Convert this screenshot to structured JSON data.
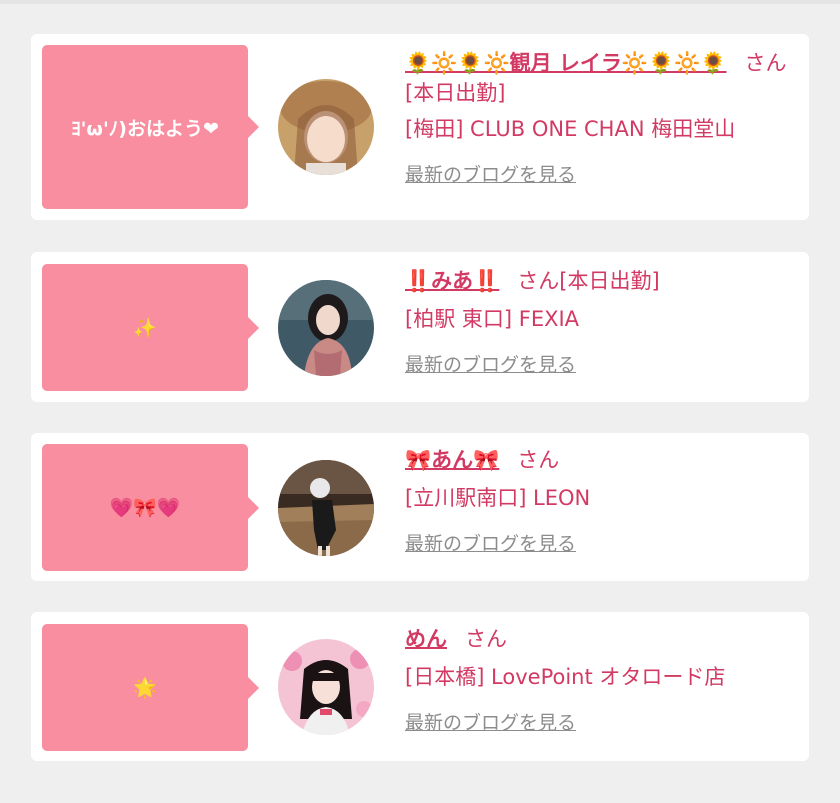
{
  "posts": [
    {
      "bubble": "ﾖ'ω'ﾉ)おはよう❤",
      "name": "🌻🔆🌻🔆観月 レイラ🔆🌻🔆🌻",
      "honorific": "さん",
      "status": "[本日出勤]",
      "shop": "[梅田] CLUB ONE CHAN 梅田堂山",
      "blog_link": "最新のブログを見る"
    },
    {
      "bubble": "✨",
      "name": "‼️みあ‼️",
      "honorific": "さん",
      "status": "[本日出勤]",
      "shop": "[柏駅 東口] FEXIA",
      "blog_link": "最新のブログを見る"
    },
    {
      "bubble": "💗🎀💗",
      "name": "🎀あん🎀",
      "honorific": "さん",
      "status": "",
      "shop": "[立川駅南口] LEON",
      "blog_link": "最新のブログを見る"
    },
    {
      "bubble": "🌟",
      "name": "めん",
      "honorific": "さん",
      "status": "",
      "shop": "[日本橋] LovePoint オタロード店",
      "blog_link": "最新のブログを見る"
    }
  ],
  "colors": {
    "accent": "#d23a64",
    "bubble": "#f88ea0",
    "link_gray": "#8c8c8c",
    "background": "#efefef"
  }
}
